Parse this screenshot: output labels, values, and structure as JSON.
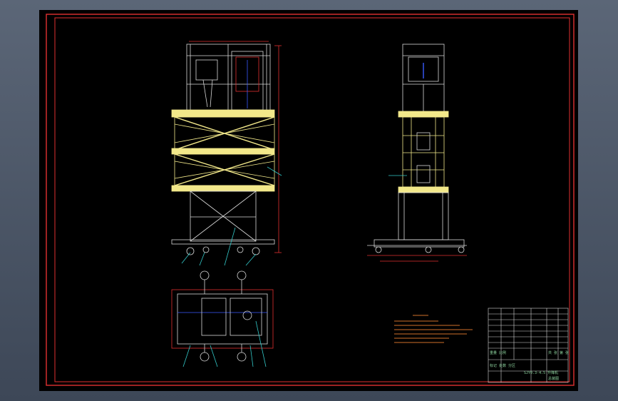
{
  "colors": {
    "viewport_bg": "#4a5566",
    "sheet_bg": "#000000",
    "border": "#e03030",
    "frame_line": "#d8d8d8",
    "member_fill": "#f2e88a",
    "leader": "#33c9c9",
    "dimension": "#e03030",
    "note_text": "#d0702a",
    "title_text": "#8fd6a0",
    "accent_blue": "#3a5cff"
  },
  "title_block": {
    "left_col": "重量 比例",
    "right_col": "共 张 第 张",
    "bottom_left": "标记 处数 分区",
    "bottom_mid": "SJY0.3-4.5 升降机",
    "bottom_right": "总装图"
  }
}
